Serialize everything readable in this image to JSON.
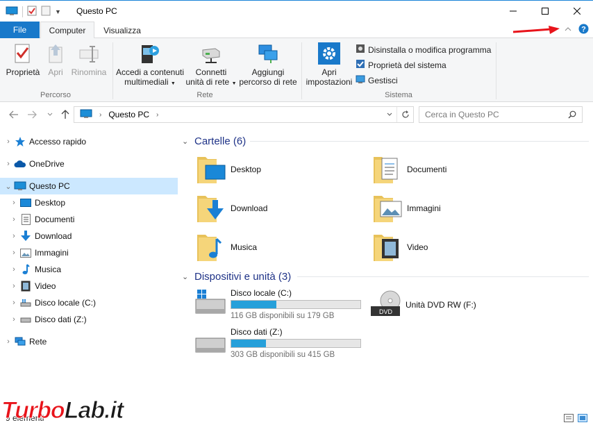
{
  "window": {
    "title": "Questo PC"
  },
  "tabs": {
    "file": "File",
    "computer": "Computer",
    "view": "Visualizza"
  },
  "ribbon": {
    "properties": "Proprietà",
    "open": "Apri",
    "rename": "Rinomina",
    "group_location": "Percorso",
    "media_line1": "Accedi a contenuti",
    "media_line2": "multimediali",
    "map_line1": "Connetti",
    "map_line2": "unità di rete",
    "addloc_line1": "Aggiungi",
    "addloc_line2": "percorso di rete",
    "group_network": "Rete",
    "settings_line1": "Apri",
    "settings_line2": "impostazioni",
    "uninstall": "Disinstalla o modifica programma",
    "sysprops": "Proprietà del sistema",
    "manage": "Gestisci",
    "group_system": "Sistema"
  },
  "address": {
    "crumb": "Questo PC",
    "search_placeholder": "Cerca in Questo PC"
  },
  "nav": {
    "quick_access": "Accesso rapido",
    "onedrive": "OneDrive",
    "this_pc": "Questo PC",
    "desktop": "Desktop",
    "documents": "Documenti",
    "downloads": "Download",
    "pictures": "Immagini",
    "music": "Musica",
    "videos": "Video",
    "local_disk": "Disco locale (C:)",
    "data_disk": "Disco dati (Z:)",
    "network": "Rete"
  },
  "content": {
    "folders_header": "Cartelle (6)",
    "folders": [
      "Desktop",
      "Documenti",
      "Download",
      "Immagini",
      "Musica",
      "Video"
    ],
    "devices_header": "Dispositivi e unità (3)",
    "drives": [
      {
        "name": "Disco locale (C:)",
        "free": "116 GB disponibili su 179 GB",
        "used_fraction": 0.35
      },
      {
        "name": "Disco dati (Z:)",
        "free": "303 GB disponibili su 415 GB",
        "used_fraction": 0.27
      }
    ],
    "dvd": "Unità DVD RW (F:)"
  },
  "status": {
    "count": "9 elementi"
  },
  "watermark": {
    "part1": "Turbo",
    "part2": "Lab.it"
  },
  "colors": {
    "accent": "#1979ca",
    "selection": "#cce8ff",
    "header_blue": "#1e3287",
    "bar_fill": "#26a0da",
    "annot_red": "#e8141b"
  }
}
